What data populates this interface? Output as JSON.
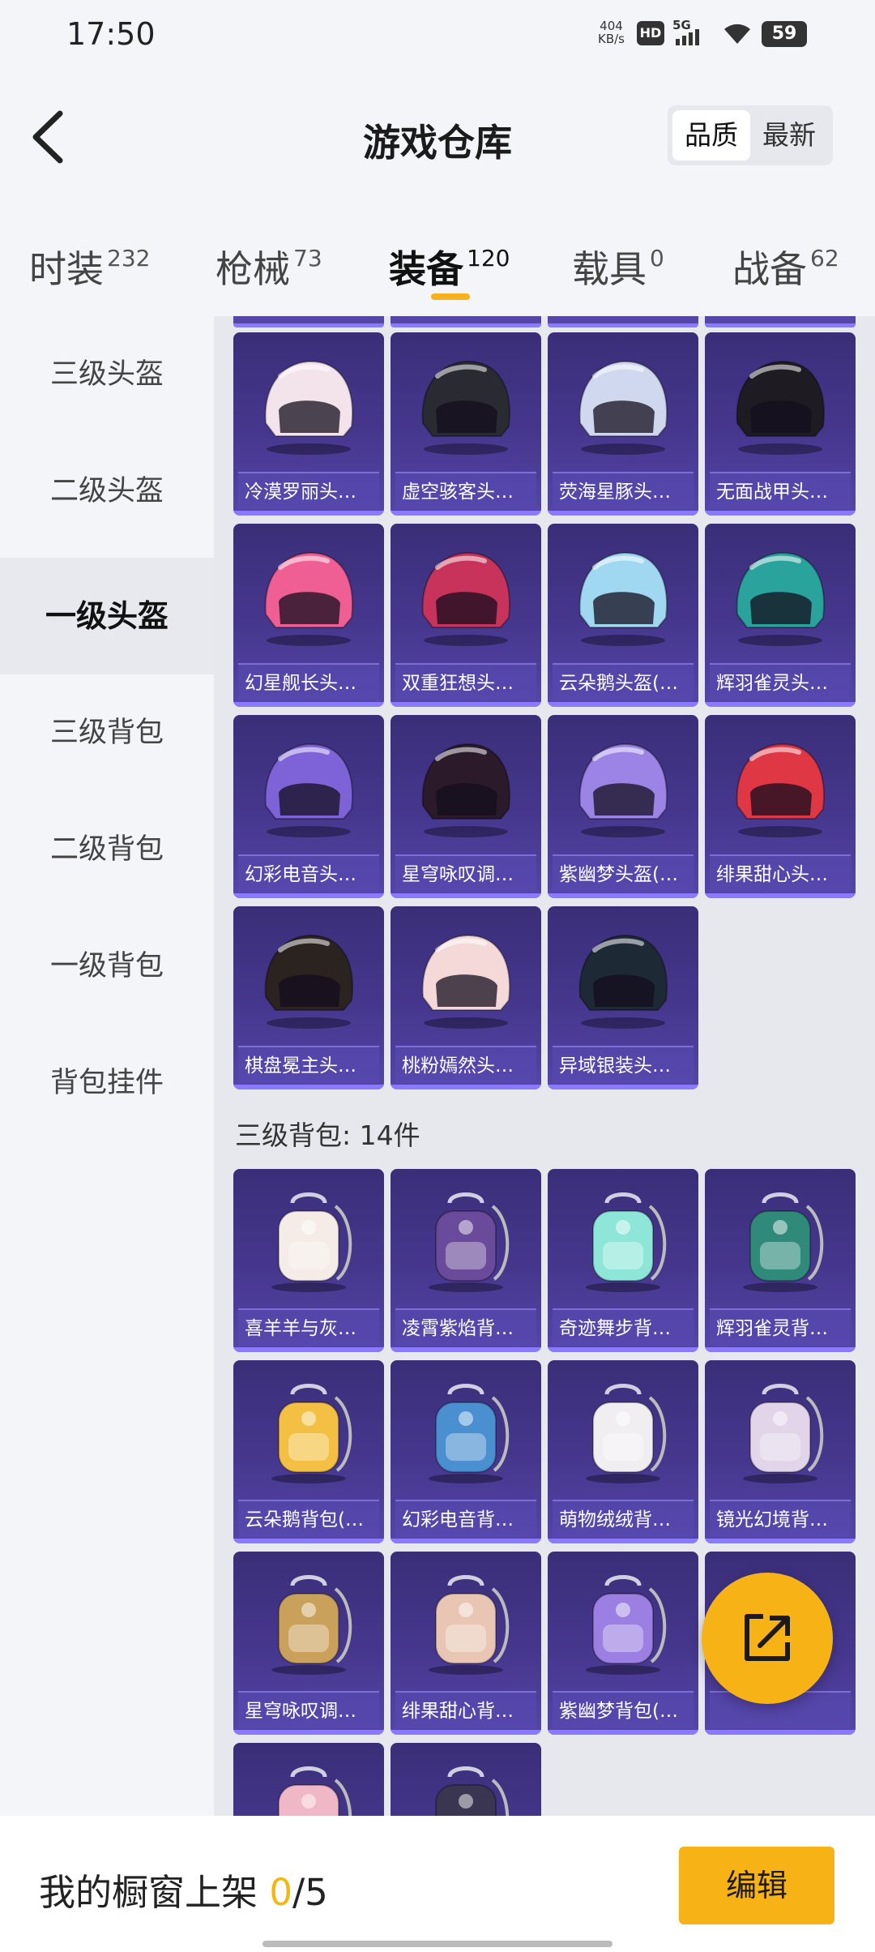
{
  "status_bar": {
    "time": "17:50",
    "net_speed": "404",
    "net_unit": "KB/s",
    "hd": "HD",
    "signal": "5G",
    "battery": "59"
  },
  "header": {
    "title": "游戏仓库",
    "sort_options": [
      "品质",
      "最新"
    ],
    "sort_selected": "品质"
  },
  "tabs": [
    {
      "label": "时装",
      "count": "232"
    },
    {
      "label": "枪械",
      "count": "73"
    },
    {
      "label": "装备",
      "count": "120",
      "active": true
    },
    {
      "label": "载具",
      "count": "0"
    },
    {
      "label": "战备",
      "count": "62"
    }
  ],
  "sidebar": [
    {
      "label": "三级头盔"
    },
    {
      "label": "二级头盔"
    },
    {
      "label": "一级头盔",
      "active": true
    },
    {
      "label": "三级背包"
    },
    {
      "label": "二级背包"
    },
    {
      "label": "一级背包"
    },
    {
      "label": "背包挂件"
    }
  ],
  "helmets": [
    {
      "name": "冷漠罗丽头…",
      "icon": "helmet-icon",
      "color": "#f3e3ea"
    },
    {
      "name": "虚空骇客头…",
      "icon": "helmet-icon",
      "color": "#2a2a33"
    },
    {
      "name": "荧海星豚头…",
      "icon": "helmet-icon",
      "color": "#cfd8ee"
    },
    {
      "name": "无面战甲头…",
      "icon": "helmet-icon",
      "color": "#1e1c22"
    },
    {
      "name": "幻星舰长头…",
      "icon": "helmet-icon",
      "color": "#ef5f93"
    },
    {
      "name": "双重狂想头…",
      "icon": "helmet-icon",
      "color": "#c7335a"
    },
    {
      "name": "云朵鹅头盔(…",
      "icon": "helmet-icon",
      "color": "#9fd8f0"
    },
    {
      "name": "辉羽雀灵头…",
      "icon": "helmet-icon",
      "color": "#2aa39c"
    },
    {
      "name": "幻彩电音头…",
      "icon": "helmet-icon",
      "color": "#7e63d8"
    },
    {
      "name": "星穹咏叹调…",
      "icon": "helmet-icon",
      "color": "#2a1a2a"
    },
    {
      "name": "紫幽梦头盔(…",
      "icon": "helmet-icon",
      "color": "#9b84e6"
    },
    {
      "name": "绯果甜心头…",
      "icon": "helmet-icon",
      "color": "#e03744"
    },
    {
      "name": "棋盘冕主头…",
      "icon": "helmet-icon",
      "color": "#2b2320"
    },
    {
      "name": "桃粉嫣然头…",
      "icon": "helmet-icon",
      "color": "#f5d9d9"
    },
    {
      "name": "异域银装头…",
      "icon": "helmet-icon",
      "color": "#1d2a36"
    }
  ],
  "section_backpack": {
    "label": "三级背包: 14件"
  },
  "backpacks": [
    {
      "name": "喜羊羊与灰…",
      "icon": "backpack-icon",
      "color": "#f5ece7"
    },
    {
      "name": "凌霄紫焰背…",
      "icon": "backpack-icon",
      "color": "#6a4a9a"
    },
    {
      "name": "奇迹舞步背…",
      "icon": "backpack-icon",
      "color": "#8ee6d8"
    },
    {
      "name": "辉羽雀灵背…",
      "icon": "backpack-icon",
      "color": "#2f8a7a"
    },
    {
      "name": "云朵鹅背包(…",
      "icon": "backpack-icon",
      "color": "#f3c043"
    },
    {
      "name": "幻彩电音背…",
      "icon": "backpack-icon",
      "color": "#4a8fd0"
    },
    {
      "name": "萌物绒绒背…",
      "icon": "backpack-icon",
      "color": "#f1eef2"
    },
    {
      "name": "镜光幻境背…",
      "icon": "backpack-icon",
      "color": "#e2d5ea"
    },
    {
      "name": "星穹咏叹调…",
      "icon": "backpack-icon",
      "color": "#c9a15b"
    },
    {
      "name": "绯果甜心背…",
      "icon": "backpack-icon",
      "color": "#e8c6b3"
    },
    {
      "name": "紫幽梦背包(…",
      "icon": "backpack-icon",
      "color": "#9c7fe2"
    },
    {
      "name": "",
      "icon": "backpack-icon",
      "color": "#2a3a44"
    }
  ],
  "fab": {
    "icon": "share-external-icon"
  },
  "bottom": {
    "label": "我的橱窗上架",
    "current": "0",
    "separator_total": "/5",
    "edit_label": "编辑"
  }
}
